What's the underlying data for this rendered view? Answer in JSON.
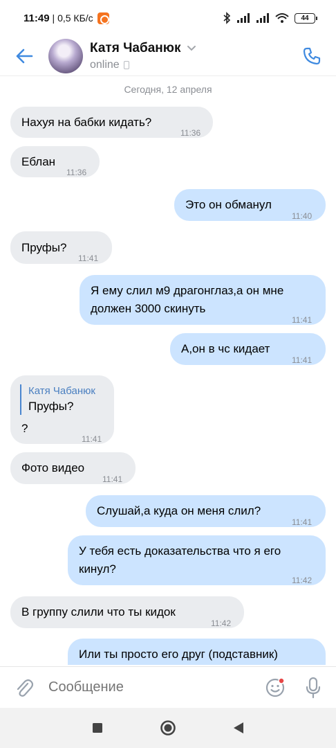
{
  "status_bar": {
    "time": "11:49",
    "speed": "| 0,5 КБ/с",
    "battery": "44"
  },
  "header": {
    "contact_name": "Катя Чабанюк",
    "status": "online"
  },
  "chat": {
    "date_separator": "Сегодня, 12 апреля",
    "messages": [
      {
        "text": "Нахуя на бабки кидать?",
        "time": "11:36"
      },
      {
        "text": "Еблан",
        "time": "11:36"
      },
      {
        "text": "Это он обманул",
        "time": "11:40"
      },
      {
        "text": "Пруфы?",
        "time": "11:41"
      },
      {
        "line1": "Я ему слил м9 драгонглаз,а он мне",
        "line2": "должен 3000 скинуть",
        "time": "11:41"
      },
      {
        "text": "А,он в чс кидает",
        "time": "11:41"
      },
      {
        "reply_author": "Катя Чабанюк",
        "reply_text": "Пруфы?",
        "text": "?",
        "time": "11:41"
      },
      {
        "text": "Фото видео",
        "time": "11:41"
      },
      {
        "text": "Слушай,а куда он меня слил?",
        "time": "11:41"
      },
      {
        "line1": "У тебя есть доказательства что я его",
        "line2": "кинул?",
        "time": "11:42"
      },
      {
        "text": "В группу слили что ты кидок",
        "time": "11:42"
      },
      {
        "text": "Или ты просто его друг (подставник)"
      }
    ]
  },
  "composer": {
    "placeholder": "Сообщение"
  },
  "colors": {
    "incoming": "#eaecef",
    "outgoing": "#cce4ff",
    "accent": "#4a86cf"
  }
}
